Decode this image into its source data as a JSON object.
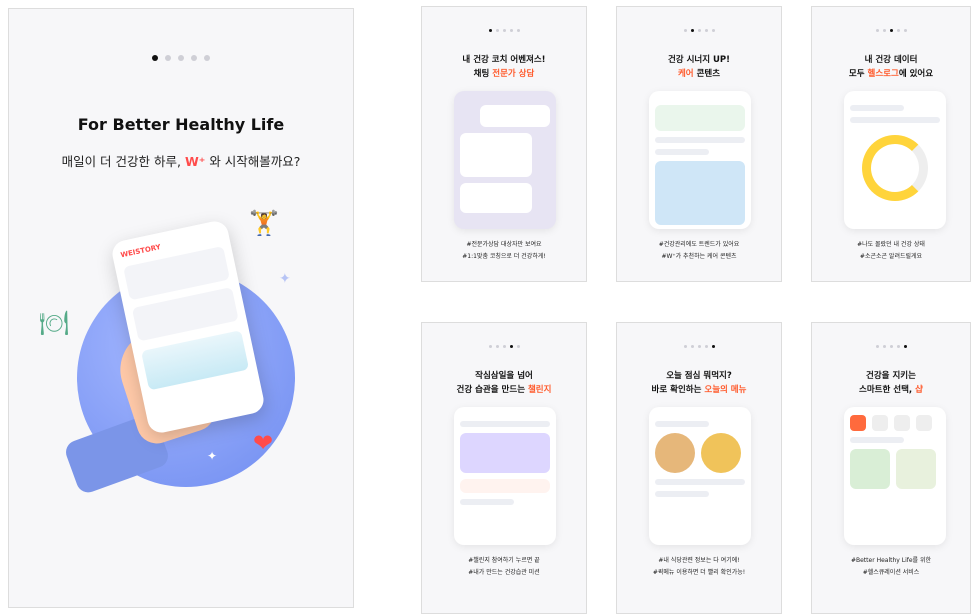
{
  "hero": {
    "pager_dots": 5,
    "active_dot": 0,
    "title": "For Better Healthy Life",
    "subtitle_before": "매일이 더 건강한 하루,",
    "subtitle_after": "와 시작해볼까요?",
    "brand_mark": "W⁺",
    "phone_logo": "WEISTORY",
    "colors": {
      "accent": "#ff4b4b",
      "circle": "#6f8cf0"
    }
  },
  "cards": [
    {
      "line1_pre": "내 건강 코치 어벤져스!",
      "line1_hl": "",
      "line1_post": "",
      "line2_pre": "채팅 ",
      "line2_hl": "전문가 상담",
      "line2_post": "",
      "cap1": "#전문가상담 대상자만 보여요",
      "cap2": "#1:1맞춤 코칭으로 더 건강하게!"
    },
    {
      "line1_pre": "건강 시너지 UP!",
      "line1_hl": "",
      "line1_post": "",
      "line2_pre": "",
      "line2_hl": "케어",
      "line2_post": " 콘텐츠",
      "cap1": "#건강관리에도 트렌드가 있어요",
      "cap2": "#W⁺가 추천하는 케어 콘텐츠"
    },
    {
      "line1_pre": "내 건강 데이터",
      "line1_hl": "",
      "line1_post": "",
      "line2_pre": "모두 ",
      "line2_hl": "헬스로그",
      "line2_post": "에 있어요",
      "cap1": "#나도 몰랐던 내 건강 상태",
      "cap2": "#소곤소곤 알려드릴게요"
    },
    {
      "line1_pre": "작심삼일을 넘어",
      "line1_hl": "",
      "line1_post": "",
      "line2_pre": "건강 습관을 만드는 ",
      "line2_hl": "챌린지",
      "line2_post": "",
      "cap1": "#챌린지 참여하기 누르면 끝",
      "cap2": "#내가 만드는 건강습관 미션"
    },
    {
      "line1_pre": "오늘 점심 뭐먹지?",
      "line1_hl": "",
      "line1_post": "",
      "line2_pre": "바로 확인하는 ",
      "line2_hl": "오늘의 메뉴",
      "line2_post": "",
      "cap1": "#내 식당관련 정보는 다 여기에!",
      "cap2": "#퀵메뉴 이용하면 더 빨리 확인가능!"
    },
    {
      "line1_pre": "건강을 지키는",
      "line1_hl": "",
      "line1_post": "",
      "line2_pre": "스마트한 선택, ",
      "line2_hl": "샵",
      "line2_post": "",
      "cap1": "#Better Healthy Life를 위한",
      "cap2": "#헬스큐레이션 서비스"
    }
  ],
  "highlight_color": "#ff5a2c"
}
